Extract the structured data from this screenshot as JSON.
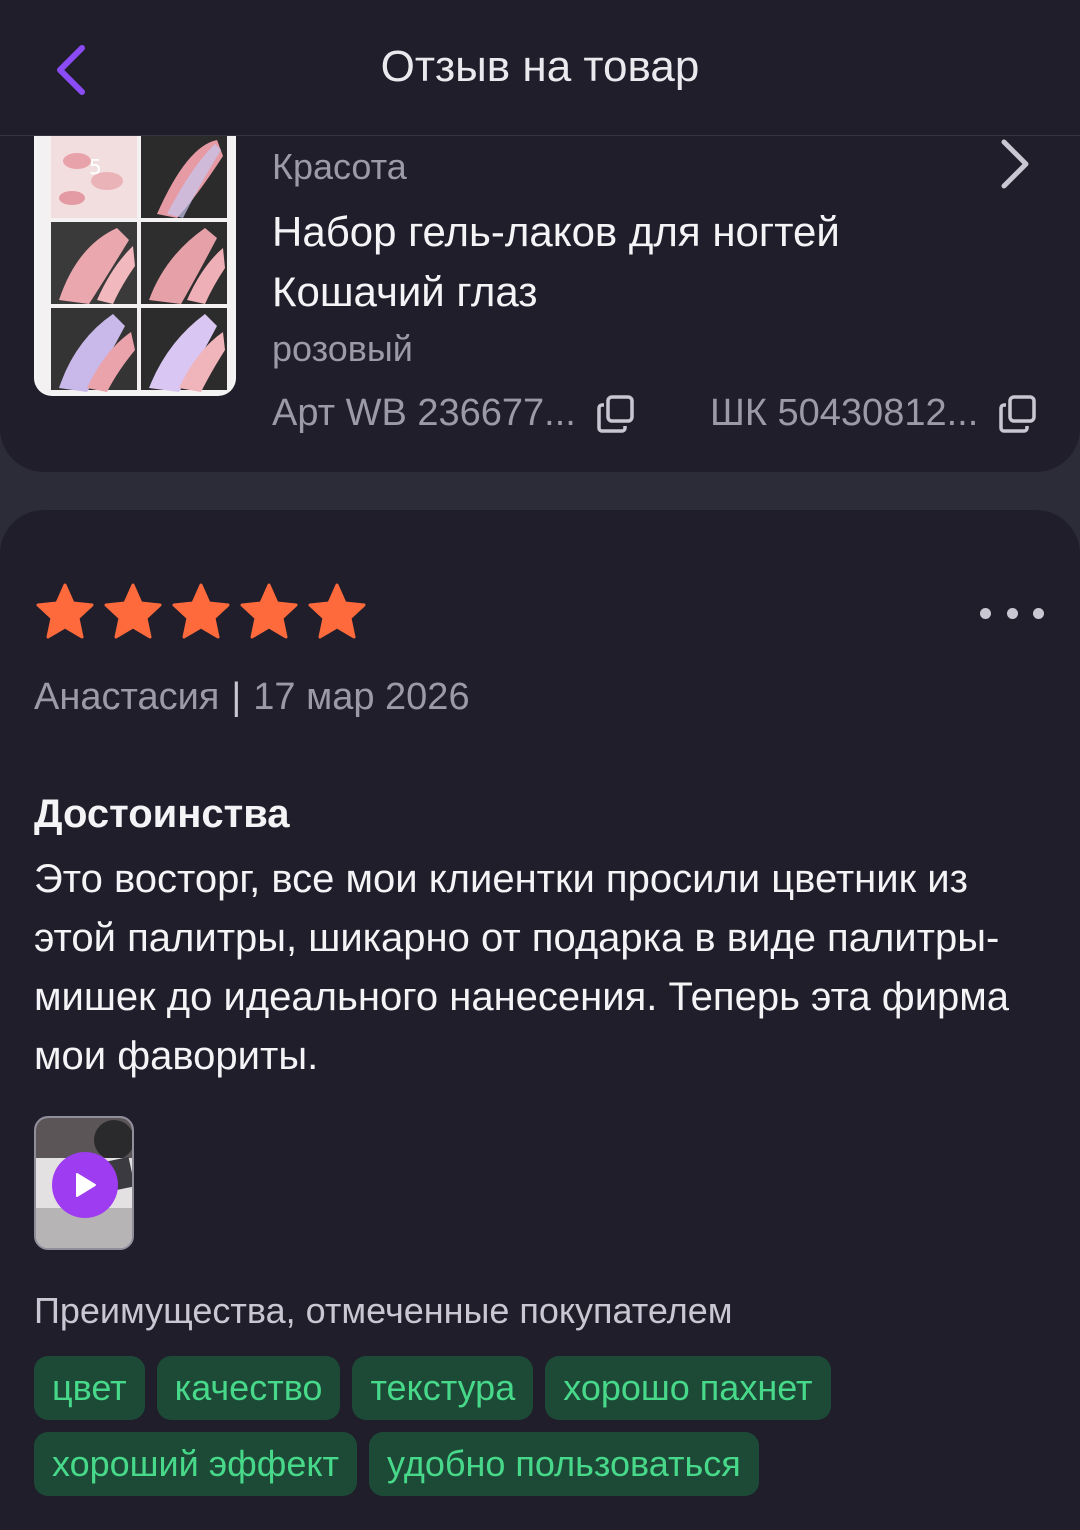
{
  "header": {
    "title": "Отзыв на товар",
    "back_icon": "chevron-left-icon",
    "accent_color": "#8c4cf5"
  },
  "product": {
    "category": "Красота",
    "name": "Набор гель-лаков для ногтей Кошачий глаз",
    "color": "розовый",
    "art": "Арт WB 236677...",
    "barcode": "ШК 50430812...",
    "thumb_number": "5"
  },
  "review": {
    "rating": 5,
    "star_color": "#ff6a3d",
    "author": "Анастасия",
    "separator": "|",
    "date": "17 мар 2026",
    "section_title": "Достоинства",
    "text": "Это восторг, все мои клиентки просили цветник из этой палитры, шикарно от подарка в виде палитры-мишек до идеального нанесения. Теперь эта фирма мои фавориты.",
    "video_icon": "play-icon",
    "benefits_label": "Преимущества, отмеченные покупателем",
    "tags": [
      "цвет",
      "качество",
      "текстура",
      "хорошо пахнет",
      "хороший эффект",
      "удобно пользоваться"
    ],
    "tag_bg": "#1c4a36",
    "tag_text_color": "#48d88a"
  }
}
